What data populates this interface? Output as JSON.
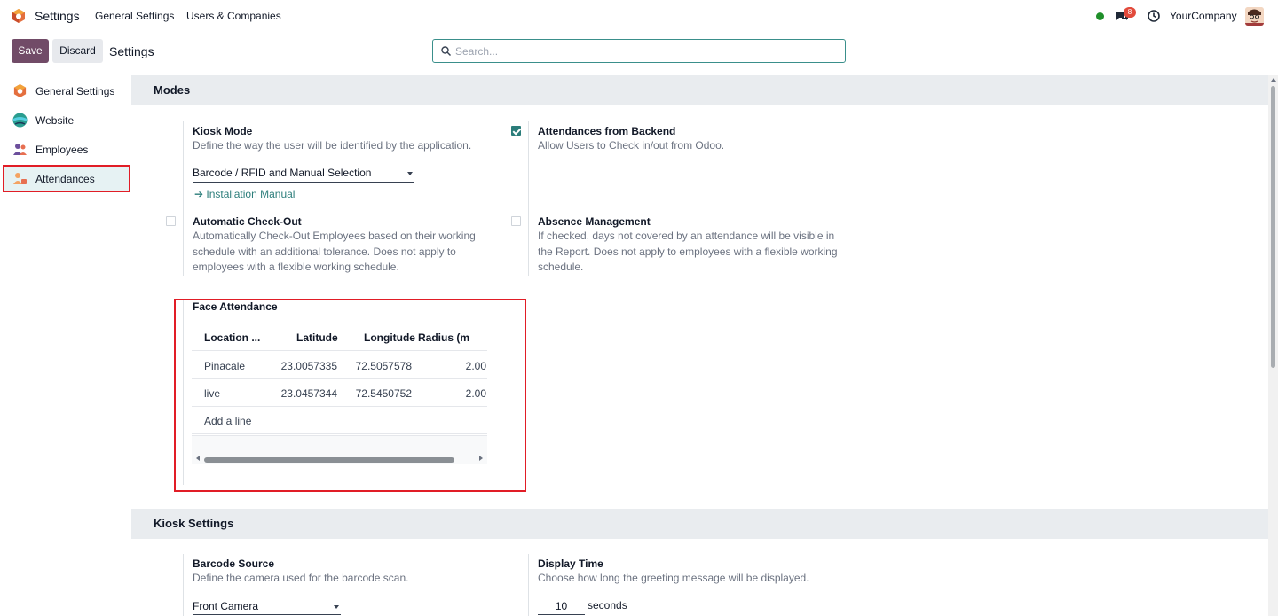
{
  "navbar": {
    "app_title": "Settings",
    "menu": [
      "General Settings",
      "Users & Companies"
    ],
    "chat_badge": "8",
    "company": "YourCompany"
  },
  "control_panel": {
    "save_label": "Save",
    "discard_label": "Discard",
    "title": "Settings",
    "search_placeholder": "Search...",
    "search_value": ""
  },
  "sidebar": {
    "items": [
      {
        "label": "General Settings",
        "icon": "odoo-logo-icon"
      },
      {
        "label": "Website",
        "icon": "website-icon"
      },
      {
        "label": "Employees",
        "icon": "employees-icon"
      },
      {
        "label": "Attendances",
        "icon": "attendances-icon",
        "active": true
      }
    ]
  },
  "modes": {
    "heading": "Modes",
    "kiosk_mode": {
      "title": "Kiosk Mode",
      "desc": "Define the way the user will be identified by the application.",
      "value": "Barcode / RFID and Manual Selection",
      "link": "Installation Manual"
    },
    "attendances_backend": {
      "title": "Attendances from Backend",
      "desc": "Allow Users to Check in/out from Odoo.",
      "checked": true
    },
    "auto_checkout": {
      "title": "Automatic Check-Out",
      "desc_lines": [
        "Automatically Check-Out Employees based on their working",
        "schedule with an additional tolerance. Does not apply to",
        "employees with a flexible working schedule."
      ],
      "checked": false
    },
    "absence": {
      "title": "Absence Management",
      "desc_lines": [
        "If checked, days not covered by an attendance will be visible in",
        "the Report. Does not apply to employees with a flexible working",
        "schedule."
      ],
      "checked": false
    },
    "face_attendance": {
      "title": "Face Attendance",
      "columns": [
        "Location ...",
        "Latitude",
        "Longitude",
        "Radius (m"
      ],
      "rows": [
        {
          "location": "Pinacale",
          "latitude": "23.0057335",
          "longitude": "72.5057578",
          "radius": "2.00"
        },
        {
          "location": "live",
          "latitude": "23.0457344",
          "longitude": "72.5450752",
          "radius": "2.00"
        }
      ],
      "add_line": "Add a line"
    }
  },
  "kiosk_settings": {
    "heading": "Kiosk Settings",
    "barcode_source": {
      "title": "Barcode Source",
      "desc": "Define the camera used for the barcode scan.",
      "value": "Front Camera"
    },
    "display_time": {
      "title": "Display Time",
      "desc": "Choose how long the greeting message will be displayed.",
      "value": "10",
      "unit": "seconds"
    }
  },
  "colors": {
    "brand": "#714b67",
    "accent": "#2b7d7a",
    "highlight": "#e11d26",
    "badge": "#e24a3b",
    "status": "#1f8f2a"
  }
}
